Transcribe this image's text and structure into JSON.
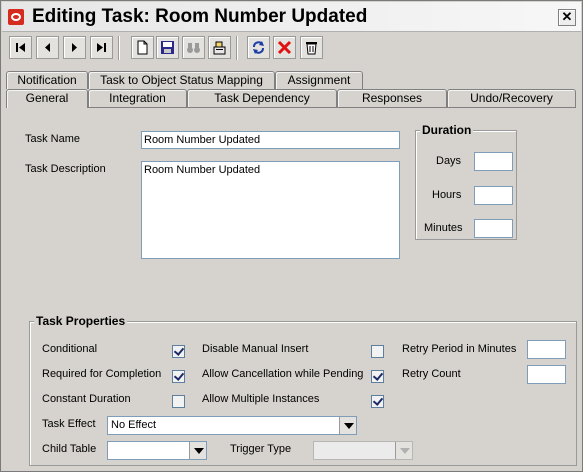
{
  "window": {
    "title": "Editing Task: Room Number Updated",
    "close_glyph": "✕"
  },
  "toolbar": {
    "buttons": [
      {
        "name": "first-record-icon"
      },
      {
        "name": "previous-record-icon"
      },
      {
        "name": "next-record-icon"
      },
      {
        "name": "last-record-icon"
      },
      {
        "name": "new-document-icon"
      },
      {
        "name": "save-icon"
      },
      {
        "name": "find-binoculars-icon"
      },
      {
        "name": "query-icon"
      },
      {
        "name": "refresh-icon"
      },
      {
        "name": "delete-x-icon"
      },
      {
        "name": "trash-icon"
      }
    ]
  },
  "tabs_row1": [
    "Notification",
    "Task to Object Status Mapping",
    "Assignment"
  ],
  "tabs_row2": [
    "General",
    "Integration",
    "Task Dependency",
    "Responses",
    "Undo/Recovery"
  ],
  "active_tab": "General",
  "general": {
    "task_name_label": "Task Name",
    "task_name_value": "Room Number Updated",
    "task_description_label": "Task Description",
    "task_description_value": "Room Number Updated",
    "duration": {
      "title": "Duration",
      "days_label": "Days",
      "days_value": "",
      "hours_label": "Hours",
      "hours_value": "",
      "minutes_label": "Minutes",
      "minutes_value": ""
    },
    "properties": {
      "title": "Task Properties",
      "conditional_label": "Conditional",
      "conditional_checked": true,
      "required_label": "Required for Completion",
      "required_checked": true,
      "constant_label": "Constant Duration",
      "constant_checked": false,
      "disable_manual_label": "Disable Manual Insert",
      "disable_manual_checked": false,
      "allow_cancel_label": "Allow Cancellation while Pending",
      "allow_cancel_checked": true,
      "allow_multiple_label": "Allow Multiple Instances",
      "allow_multiple_checked": true,
      "retry_period_label": "Retry Period in Minutes",
      "retry_period_value": "",
      "retry_count_label": "Retry Count",
      "retry_count_value": "",
      "task_effect_label": "Task Effect",
      "task_effect_value": "No Effect",
      "child_table_label": "Child Table",
      "child_table_value": "",
      "trigger_type_label": "Trigger Type",
      "trigger_type_value": ""
    }
  }
}
